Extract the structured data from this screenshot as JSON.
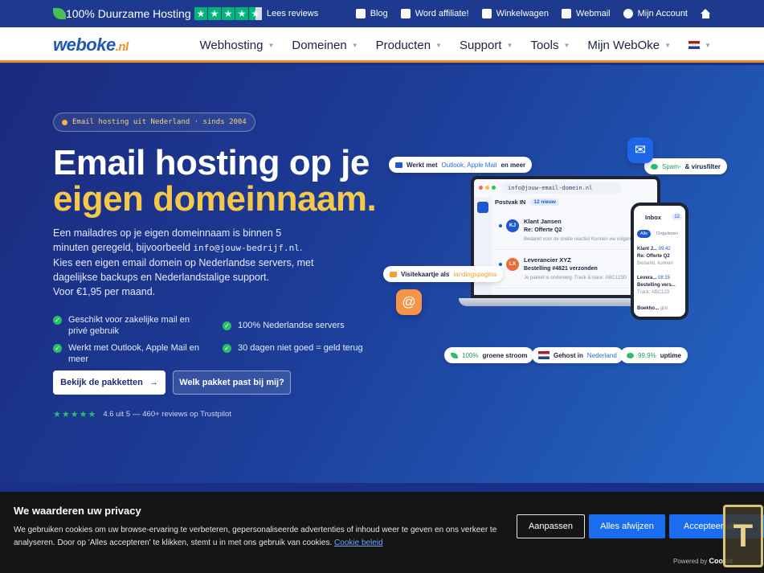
{
  "topbar": {
    "tagline": "100% Duurzame Hosting",
    "reviews_link": "Lees reviews",
    "links": [
      "Blog",
      "Word affiliate!",
      "Winkelwagen",
      "Webmail",
      "Mijn Account"
    ]
  },
  "nav": {
    "logo_main": "weboke",
    "logo_tld": ".nl",
    "items": [
      "Webhosting",
      "Domeinen",
      "Producten",
      "Support",
      "Tools",
      "Mijn WebOke"
    ]
  },
  "hero": {
    "pill": "Email hosting uit Nederland · sinds 2004",
    "title_line1": "Email hosting op je",
    "title_line2": "eigen domeinnaam.",
    "intro_a": "Een mailadres op je eigen domeinnaam is binnen 5 minuten geregeld, bijvoorbeeld ",
    "intro_mono": "info@jouw-bedrijf.nl",
    "intro_b": ".",
    "intro_c": "Kies een eigen email domein op Nederlandse servers, met dagelijkse backups en Nederlandstalige support.",
    "intro_d": "Voor €1,95 per maand.",
    "features": [
      "Geschikt voor zakelijke mail en privé gebruik",
      "100% Nederlandse servers",
      "Werkt met Outlook, Apple Mail en meer",
      "30 dagen niet goed = geld terug"
    ],
    "btn_primary": "Bekijk de pakketten",
    "btn_secondary": "Welk pakket past bij mij?",
    "rating_score": "4.6 uit 5",
    "rating_text": "— 460+ reviews op Trustpilot"
  },
  "illustration": {
    "address": "info@jouw-email-domein.nl",
    "inbox_label": "Postvak IN",
    "inbox_count": "12 nieuw",
    "mails": [
      {
        "initials": "KJ",
        "name": "Klant Jansen",
        "subject": "Re: Offerte Q2",
        "preview": "Bedankt voor de snelle reactie! Kunnen we volgende",
        "color": "#1e57d0"
      },
      {
        "initials": "LX",
        "name": "Leverancier XYZ",
        "subject": "Bestelling #4821 verzonden",
        "preview": "Je pakket is onderweg. Track & trace: ABC123D",
        "color": "#ef6a3a"
      }
    ],
    "phone_title": "Inbox",
    "phone_count": "12",
    "phone_tab_all": "Alle",
    "phone_tab_unread": "Ongelezen",
    "phone_mail1_name": "Klant J...",
    "phone_mail1_time": "09:42",
    "phone_mail1_subject": "Re: Offerte Q2",
    "phone_mail1_preview": "Bedankt, kunnen",
    "phone_mail2_name": "Levera...",
    "phone_mail2_time": "08:15",
    "phone_mail2_subject": "Bestelling vers...",
    "phone_mail2_preview": "Track: ABC123",
    "phone_mail3_name": "Boekho...",
    "phone_mail3_time": "gist",
    "chip_outlook_a": "Werkt met",
    "chip_outlook_b": "Outlook, Apple Mail",
    "chip_outlook_c": "en meer",
    "chip_spam_a": "Spam-",
    "chip_spam_b": "& virusfilter",
    "chip_card_a": "Visitekaartje als",
    "chip_card_b": "landingspagina",
    "chip_green_a": "100%",
    "chip_green_b": "groene stroom",
    "chip_nl_a": "Gehost in",
    "chip_nl_b": "Nederland",
    "chip_uptime_a": "99,9%",
    "chip_uptime_b": "uptime"
  },
  "cookie": {
    "title": "We waarderen uw privacy",
    "text": "We gebruiken cookies om uw browse-ervaring te verbeteren, gepersonaliseerde advertenties of inhoud weer te geven en ons verkeer te analyseren. Door op 'Alles accepteren' te klikken, stemt u in met ons gebruik van cookies.",
    "policy_link": "Cookie beleid",
    "btn_customize": "Aanpassen",
    "btn_reject": "Alles afwijzen",
    "btn_accept": "Accepteer alles",
    "powered": "Powered by",
    "powered_brand": "Cookie"
  },
  "colors": {
    "accent": "#f28c28",
    "hero_yellow": "#f5c84b",
    "trustpilot": "#00b67a",
    "cookie_blue": "#1a6dee"
  }
}
